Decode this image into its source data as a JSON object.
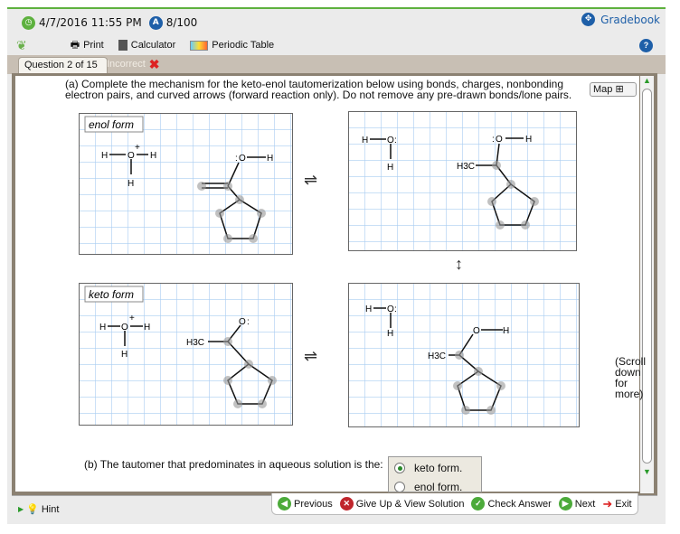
{
  "header": {
    "datetime": "4/7/2016 11:55 PM",
    "score": "8/100",
    "gradebook": "Gradebook"
  },
  "toolbar": {
    "print": "Print",
    "calculator": "Calculator",
    "periodic_table": "Periodic Table"
  },
  "tabs": {
    "question": "Question 2 of 15",
    "status": "Incorrect"
  },
  "question_a": "(a) Complete the mechanism for the keto-enol tautomerization below using bonds, charges, nonbonding electron pairs, and curved arrows (forward reaction only). Do not remove any pre-drawn bonds/lone pairs.",
  "map_label": "Map",
  "panels": {
    "enol_label": "enol form",
    "keto_label": "keto form",
    "atoms": {
      "H": "H",
      "O": "O",
      "H3C": "H3C",
      "plus": "+",
      "lp": ":"
    }
  },
  "equilibrium_symbol": "⇌",
  "resonance_symbol": "↕",
  "scroll_note": "(Scroll down for more)",
  "question_b": "(b) The tautomer that predominates in aqueous solution is the:",
  "choices": [
    {
      "label": "keto form.",
      "selected": true
    },
    {
      "label": "enol form.",
      "selected": false
    }
  ],
  "footer": {
    "hint": "Hint",
    "previous": "Previous",
    "give_up": "Give Up & View Solution",
    "check": "Check Answer",
    "next": "Next",
    "exit": "Exit"
  },
  "colors": {
    "green": "#5db13e",
    "blue": "#1e5fa8",
    "grid": "#a9cdf2"
  }
}
